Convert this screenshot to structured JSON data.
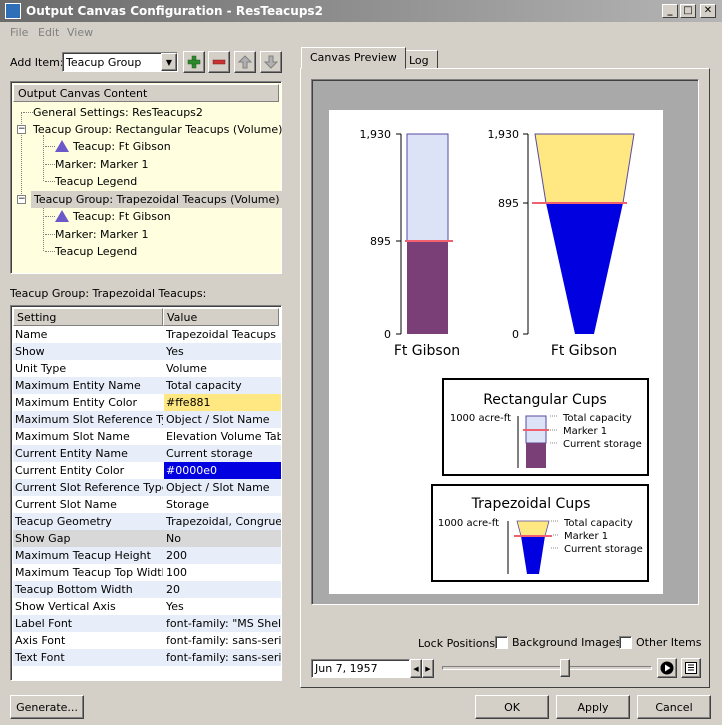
{
  "window": {
    "title": "Output Canvas Configuration - ResTeacups2",
    "controls": {
      "minimize": "_",
      "maximize": "□",
      "close": "✕"
    }
  },
  "menu": [
    "File",
    "Edit",
    "View"
  ],
  "add_item": {
    "label": "Add Item:",
    "selected": "Teacup Group"
  },
  "tree": {
    "header": "Output Canvas Content",
    "rows": [
      "General Settings: ResTeacups2",
      "Teacup Group: Rectangular Teacups (Volume)",
      "Teacup: Ft Gibson",
      "Marker: Marker 1",
      "Teacup Legend",
      "Teacup Group: Trapezoidal Teacups (Volume)",
      "Teacup: Ft Gibson",
      "Marker: Marker 1",
      "Teacup Legend"
    ]
  },
  "props_title": "Teacup Group: Trapezoidal Teacups:",
  "props": {
    "col_setting": "Setting",
    "col_value": "Value",
    "rows": [
      {
        "k": "Name",
        "v": "Trapezoidal Teacups"
      },
      {
        "k": "Show",
        "v": "Yes"
      },
      {
        "k": "Unit Type",
        "v": "Volume"
      },
      {
        "k": "Maximum Entity Name",
        "v": "Total capacity"
      },
      {
        "k": "Maximum Entity Color",
        "v": "#ffe881"
      },
      {
        "k": "Maximum Slot Reference Type",
        "v": "Object / Slot Name"
      },
      {
        "k": "Maximum Slot Name",
        "v": "Elevation Volume Table"
      },
      {
        "k": "Current Entity Name",
        "v": "Current storage"
      },
      {
        "k": "Current Entity Color",
        "v": "#0000e0"
      },
      {
        "k": "Current Slot Reference Type",
        "v": "Object / Slot Name"
      },
      {
        "k": "Current Slot Name",
        "v": "Storage"
      },
      {
        "k": "Teacup Geometry",
        "v": "Trapezoidal, Congruent"
      },
      {
        "k": "Show Gap",
        "v": "No"
      },
      {
        "k": "Maximum Teacup Height",
        "v": "200"
      },
      {
        "k": "Maximum Teacup Top Width",
        "v": "100"
      },
      {
        "k": "Teacup Bottom Width",
        "v": "20"
      },
      {
        "k": "Show Vertical Axis",
        "v": "Yes"
      },
      {
        "k": "Label Font",
        "v": "font-family: \"MS Shell…"
      },
      {
        "k": "Axis Font",
        "v": "font-family: sans-serif;"
      },
      {
        "k": "Text Font",
        "v": "font-family: sans-serif;"
      }
    ]
  },
  "tabs": [
    "Canvas Preview",
    "Log"
  ],
  "preview": {
    "rect_cup": {
      "max": "1,930",
      "marker": "895",
      "zero": "0",
      "label": "Ft Gibson"
    },
    "trap_cup": {
      "max": "1,930",
      "marker": "895",
      "zero": "0",
      "label": "Ft Gibson"
    },
    "legend_rect": {
      "title": "Rectangular Cups",
      "scale": "1000 acre-ft",
      "items": [
        "Total capacity",
        "Marker 1",
        "Current storage"
      ]
    },
    "legend_trap": {
      "title": "Trapezoidal Cups",
      "scale": "1000 acre-ft",
      "items": [
        "Total capacity",
        "Marker 1",
        "Current storage"
      ]
    }
  },
  "lock": {
    "label": "Lock Positions:",
    "bg": "Background Images",
    "other": "Other Items"
  },
  "date": "Jun 7, 1957",
  "buttons": {
    "generate": "Generate...",
    "ok": "OK",
    "apply": "Apply",
    "cancel": "Cancel"
  },
  "colors": {
    "rect_current": "#7b3f78",
    "rect_capacity": "#dde3f7",
    "trap_capacity": "#ffe881",
    "trap_current": "#0000e0",
    "marker": "#f06070",
    "tree_bg": "#ffffe0",
    "row_alt": "#e8eef9"
  }
}
